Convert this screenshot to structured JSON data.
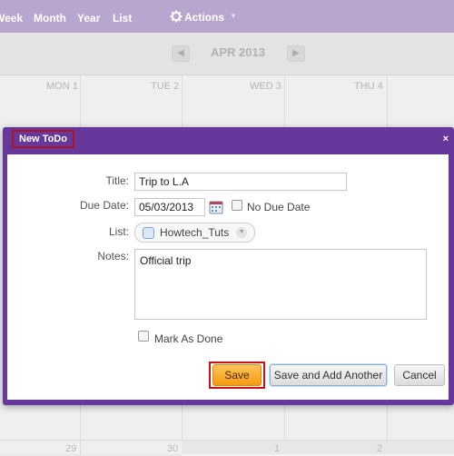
{
  "toolbar": {
    "views": [
      "Week",
      "Month",
      "Year",
      "List"
    ],
    "actions_label": "Actions"
  },
  "date_nav": {
    "prev_symbol": "◀",
    "next_symbol": "▶",
    "month_label": "APR 2013"
  },
  "calendar": {
    "day_headers": [
      "MON 1",
      "TUE 2",
      "WED 3",
      "THU 4"
    ],
    "bottom_dates": [
      "29",
      "30",
      "1",
      "2"
    ]
  },
  "dialog": {
    "title": "New ToDo",
    "close_symbol": "×",
    "title_label": "Title:",
    "title_value": "Trip to L.A",
    "due_label": "Due Date:",
    "due_value": "05/03/2013",
    "no_due_label": "No Due Date",
    "list_label": "List:",
    "list_value": "Howtech_Tuts",
    "notes_label": "Notes:",
    "notes_value": "Official trip",
    "mark_done_label": "Mark As Done",
    "save_label": "Save",
    "save_add_label": "Save and Add Another",
    "cancel_label": "Cancel"
  },
  "colors": {
    "toolbar_bg": "#b8a6cf",
    "dialog_purple": "#66389c",
    "save_orange": "#f5a623",
    "highlight_red": "#c8101c"
  },
  "icons": [
    "gear-icon",
    "caret-down-icon",
    "prev-arrow-icon",
    "next-arrow-icon",
    "calendar-picker-icon",
    "close-icon",
    "list-color-swatch-icon",
    "dropdown-chevron-icon"
  ]
}
